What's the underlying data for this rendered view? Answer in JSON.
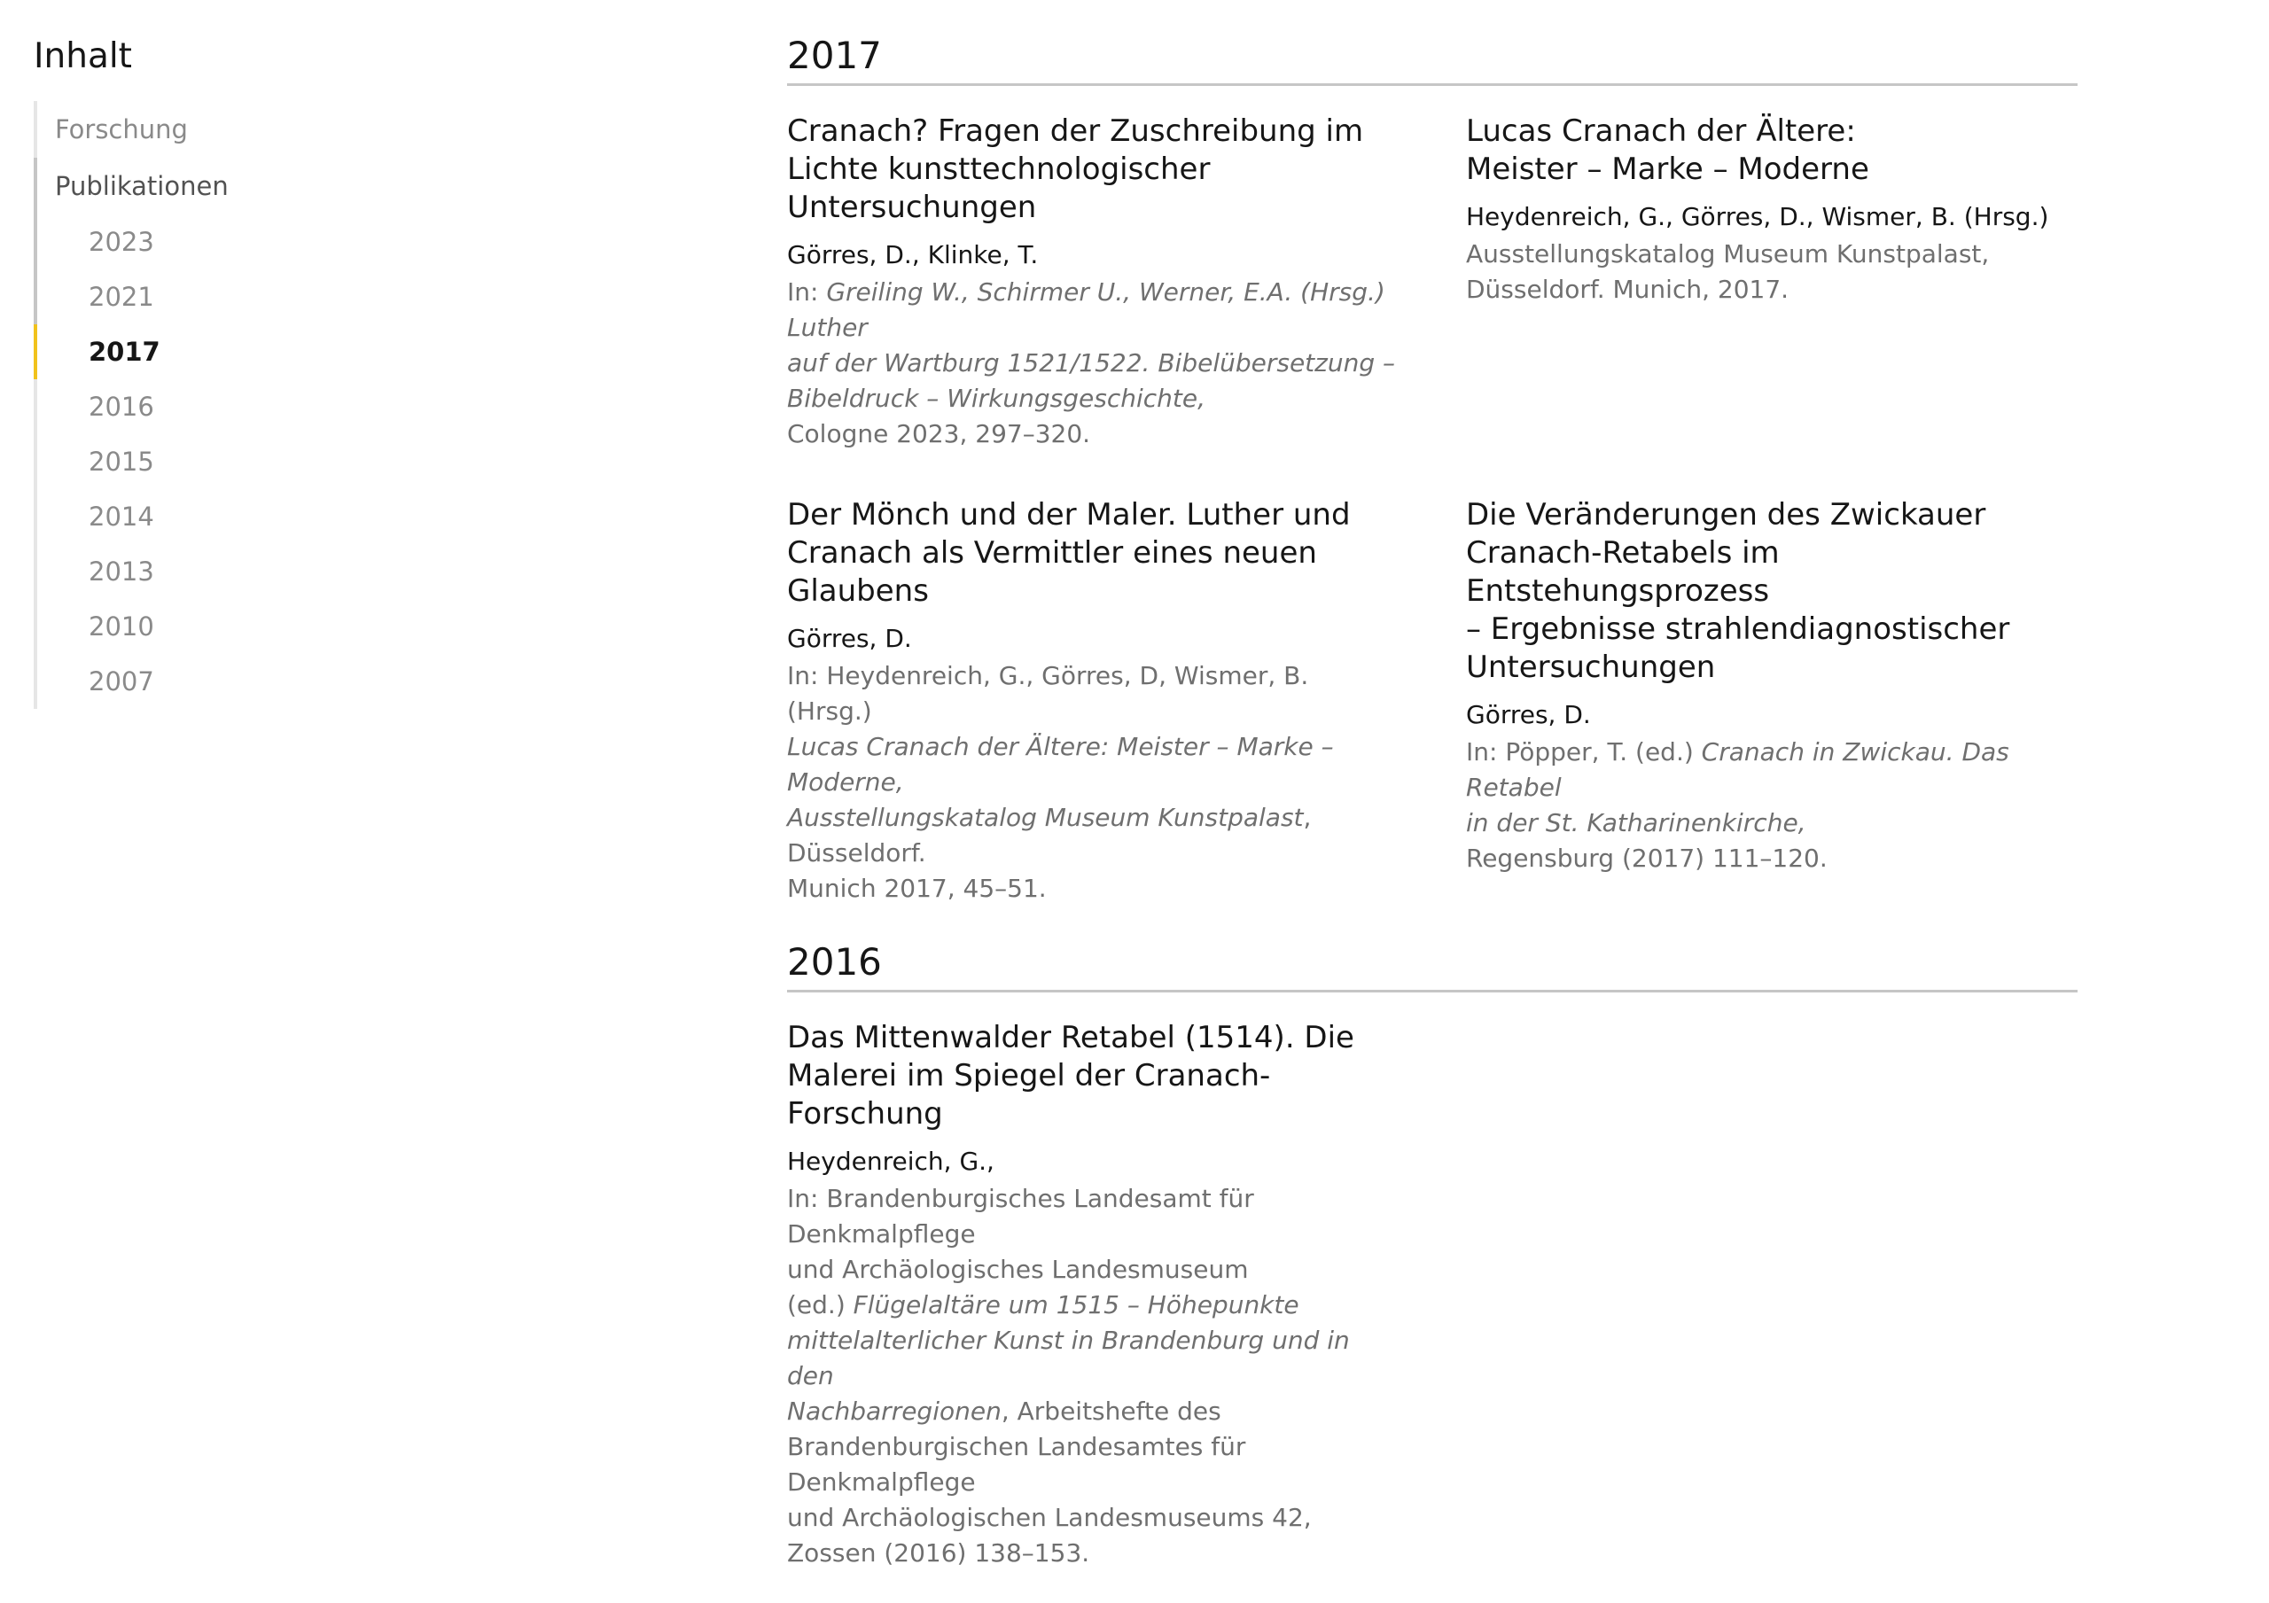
{
  "sidebar": {
    "title": "Inhalt",
    "sections": [
      {
        "label": "Forschung"
      },
      {
        "label": "Publikationen"
      }
    ],
    "years": [
      "2023",
      "2021",
      "2017",
      "2016",
      "2015",
      "2014",
      "2013",
      "2010",
      "2007"
    ],
    "active_year": "2017"
  },
  "groups": [
    {
      "year": "2017",
      "pubs": [
        {
          "title_lines": [
            "Cranach? Fragen der Zuschreibung im",
            "Lichte kunsttechnologischer",
            "Untersuchungen"
          ],
          "authors": "Görres, D., Klinke, T.",
          "source": [
            {
              "text": "In: ",
              "italic": false
            },
            {
              "text": "Greiling W., Schirmer U., Werner, E.A. (Hrsg.) Luther",
              "italic": true,
              "br": true
            },
            {
              "text": "auf der Wartburg 1521/1522. Bibelübersetzung –",
              "italic": true,
              "br": true
            },
            {
              "text": "Bibeldruck – Wirkungsgeschichte,",
              "italic": true,
              "br": true
            },
            {
              "text": "Cologne 2023, 297–320.",
              "italic": false
            }
          ]
        },
        {
          "title_lines": [
            "Lucas Cranach der Ältere:",
            "Meister – Marke – Moderne"
          ],
          "authors": "Heydenreich, G., Görres, D., Wismer, B. (Hrsg.)",
          "source": [
            {
              "text": "Ausstellungskatalog Museum Kunstpalast,",
              "italic": false,
              "br": true
            },
            {
              "text": "Düsseldorf. Munich, 2017.",
              "italic": false
            }
          ]
        },
        {
          "title_lines": [
            "Der Mönch und der Maler. Luther und",
            "Cranach als Vermittler eines neuen",
            "Glaubens"
          ],
          "authors": "Görres, D.",
          "source": [
            {
              "text": "In: Heydenreich, G., Görres, D, Wismer, B. (Hrsg.)",
              "italic": false,
              "br": true
            },
            {
              "text": "Lucas Cranach der Ältere: Meister – Marke – Moderne,",
              "italic": true,
              "br": true
            },
            {
              "text": "Ausstellungskatalog Museum Kunstpalast",
              "italic": true
            },
            {
              "text": ", Düsseldorf.",
              "italic": false,
              "br": true
            },
            {
              "text": "Munich 2017, 45–51.",
              "italic": false
            }
          ]
        },
        {
          "title_lines": [
            "Die Veränderungen des Zwickauer",
            "Cranach-Retabels im Entstehungsprozess",
            "– Ergebnisse strahlendiagnostischer",
            "Untersuchungen"
          ],
          "authors": "Görres, D.",
          "source": [
            {
              "text": "In: Pöpper, T. (ed.) ",
              "italic": false
            },
            {
              "text": "Cranach in Zwickau. Das Retabel",
              "italic": true,
              "br": true
            },
            {
              "text": "in der St. Katharinenkirche,",
              "italic": true,
              "br": true
            },
            {
              "text": "Regensburg (2017) 111–120.",
              "italic": false
            }
          ]
        }
      ]
    },
    {
      "year": "2016",
      "pubs": [
        {
          "title_lines": [
            "Das Mittenwalder Retabel (1514). Die",
            "Malerei im Spiegel der Cranach-Forschung"
          ],
          "authors": "Heydenreich, G.,",
          "source": [
            {
              "text": "In: Brandenburgisches Landesamt für Denkmalpflege",
              "italic": false,
              "br": true
            },
            {
              "text": "und Archäologisches Landesmuseum",
              "italic": false,
              "br": true
            },
            {
              "text": "(ed.) ",
              "italic": false
            },
            {
              "text": "Flügelaltäre um 1515 – Höhepunkte",
              "italic": true,
              "br": true
            },
            {
              "text": "mittelalterlicher Kunst in Brandenburg und in den",
              "italic": true,
              "br": true
            },
            {
              "text": "Nachbarregionen",
              "italic": true
            },
            {
              "text": ", Arbeitshefte des",
              "italic": false,
              "br": true
            },
            {
              "text": "Brandenburgischen Landesamtes für Denkmalpflege",
              "italic": false,
              "br": true
            },
            {
              "text": "und Archäologischen Landesmuseums 42,",
              "italic": false,
              "br": true
            },
            {
              "text": "Zossen (2016) 138–153.",
              "italic": false
            }
          ]
        }
      ]
    }
  ]
}
